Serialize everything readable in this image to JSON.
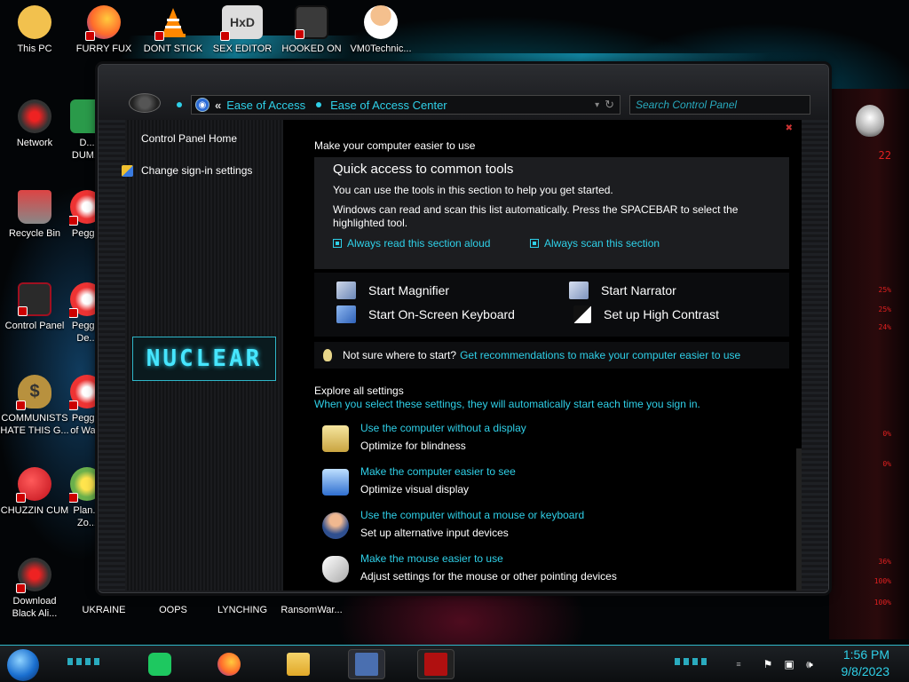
{
  "desktop": {
    "icons": [
      {
        "label": "This PC",
        "icon": "cartoon-face-icon",
        "color": "#f2c14e"
      },
      {
        "label": "FURRY FUX",
        "icon": "firefox-icon",
        "color": "#ff7139"
      },
      {
        "label": "DONT STICK",
        "icon": "vlc-cone-icon",
        "color": "#ff8800"
      },
      {
        "label": "SEX EDITOR",
        "icon": "hxd-editor-icon",
        "color": "#ddd"
      },
      {
        "label": "HOOKED ON",
        "icon": "game-maze-icon",
        "color": "#5a5a5a"
      },
      {
        "label": "VM0Technic...",
        "icon": "doctor-icon",
        "color": "#f4c08e"
      },
      {
        "label": "Network",
        "icon": "alien-network-icon",
        "color": "#c0182a"
      },
      {
        "label": "D... DUM...",
        "icon": "partial-icon",
        "color": "#2a9a4a"
      },
      {
        "label": "Recycle Bin",
        "icon": "recycle-bin-icon",
        "color": "#b33"
      },
      {
        "label": "Peggle",
        "icon": "peggle-icon",
        "color": "#e33"
      },
      {
        "label": "Control Panel",
        "icon": "control-panel-icon",
        "color": "#a01020"
      },
      {
        "label": "Peggle De...",
        "icon": "peggle-deluxe-icon",
        "color": "#e33"
      },
      {
        "label": "COMMUNISTS HATE THIS G...",
        "icon": "money-bag-icon",
        "color": "#b8913e"
      },
      {
        "label": "Peggle of Wa...",
        "icon": "peggle-war-icon",
        "color": "#e33"
      },
      {
        "label": "CHUZZIN CUM",
        "icon": "chuzzle-icon",
        "color": "#e21d2a"
      },
      {
        "label": "Plan... Zo...",
        "icon": "plants-zombies-icon",
        "color": "#6ab04c"
      },
      {
        "label": "Download Black Ali...",
        "icon": "alien-download-icon",
        "color": "#c0182a"
      },
      {
        "label": "UKRAINE",
        "icon": "shortcut-icon",
        "color": "#333"
      },
      {
        "label": "OOPS",
        "icon": "shortcut-icon",
        "color": "#333"
      },
      {
        "label": "LYNCHING",
        "icon": "shortcut-icon",
        "color": "#333"
      },
      {
        "label": "RansomWar...",
        "icon": "shortcut-icon",
        "color": "#333"
      }
    ]
  },
  "window": {
    "address": {
      "chevron": "«",
      "crumbs": [
        "Ease of Access",
        "Ease of Access Center"
      ],
      "dropdown": "▾",
      "refresh": "↻"
    },
    "search": {
      "placeholder": "Search Control Panel"
    },
    "left_pane": {
      "home": "Control Panel Home",
      "signin": "Change sign-in settings",
      "logo_text": "NUCLEAR"
    },
    "main": {
      "heading": "Make your computer easier to use",
      "quick_access": {
        "title": "Quick access to common tools",
        "desc1": "You can use the tools in this section to help you get started.",
        "desc2": "Windows can read and scan this list automatically.  Press the SPACEBAR to select the",
        "desc3": "highlighted tool.",
        "check1": "Always read this section aloud",
        "check2": "Always scan this section"
      },
      "tools": {
        "magnifier": "Start Magnifier",
        "narrator": "Start Narrator",
        "osk": "Start On-Screen Keyboard",
        "contrast": "Set up High Contrast"
      },
      "tip": {
        "text": "Not sure where to start?",
        "link": "Get recommendations to make your computer easier to use"
      },
      "explore": {
        "title": "Explore all settings",
        "desc": "When you select these settings, they will automatically start each time you sign in."
      },
      "settings": [
        {
          "link": "Use the computer without a display",
          "desc": "Optimize for blindness"
        },
        {
          "link": "Make the computer easier to see",
          "desc": "Optimize visual display"
        },
        {
          "link": "Use the computer without a mouse or keyboard",
          "desc": "Set up alternative input devices"
        },
        {
          "link": "Make the mouse easier to use",
          "desc": "Adjust settings for the mouse or other pointing devices"
        }
      ]
    }
  },
  "right_panel": {
    "readouts": [
      "22",
      "25%",
      "25%",
      "24%",
      "0%",
      "0%",
      "36%",
      "100%",
      "100%"
    ]
  },
  "taskbar": {
    "apps": [
      "notes-app",
      "firefox",
      "file-explorer",
      "control-panel",
      "alienware-app"
    ],
    "clock": {
      "time": "1:56 PM",
      "date": "9/8/2023"
    }
  },
  "colors": {
    "accent": "#2fd0e8",
    "alien_red": "#e02020",
    "window_bg": "#000000"
  }
}
